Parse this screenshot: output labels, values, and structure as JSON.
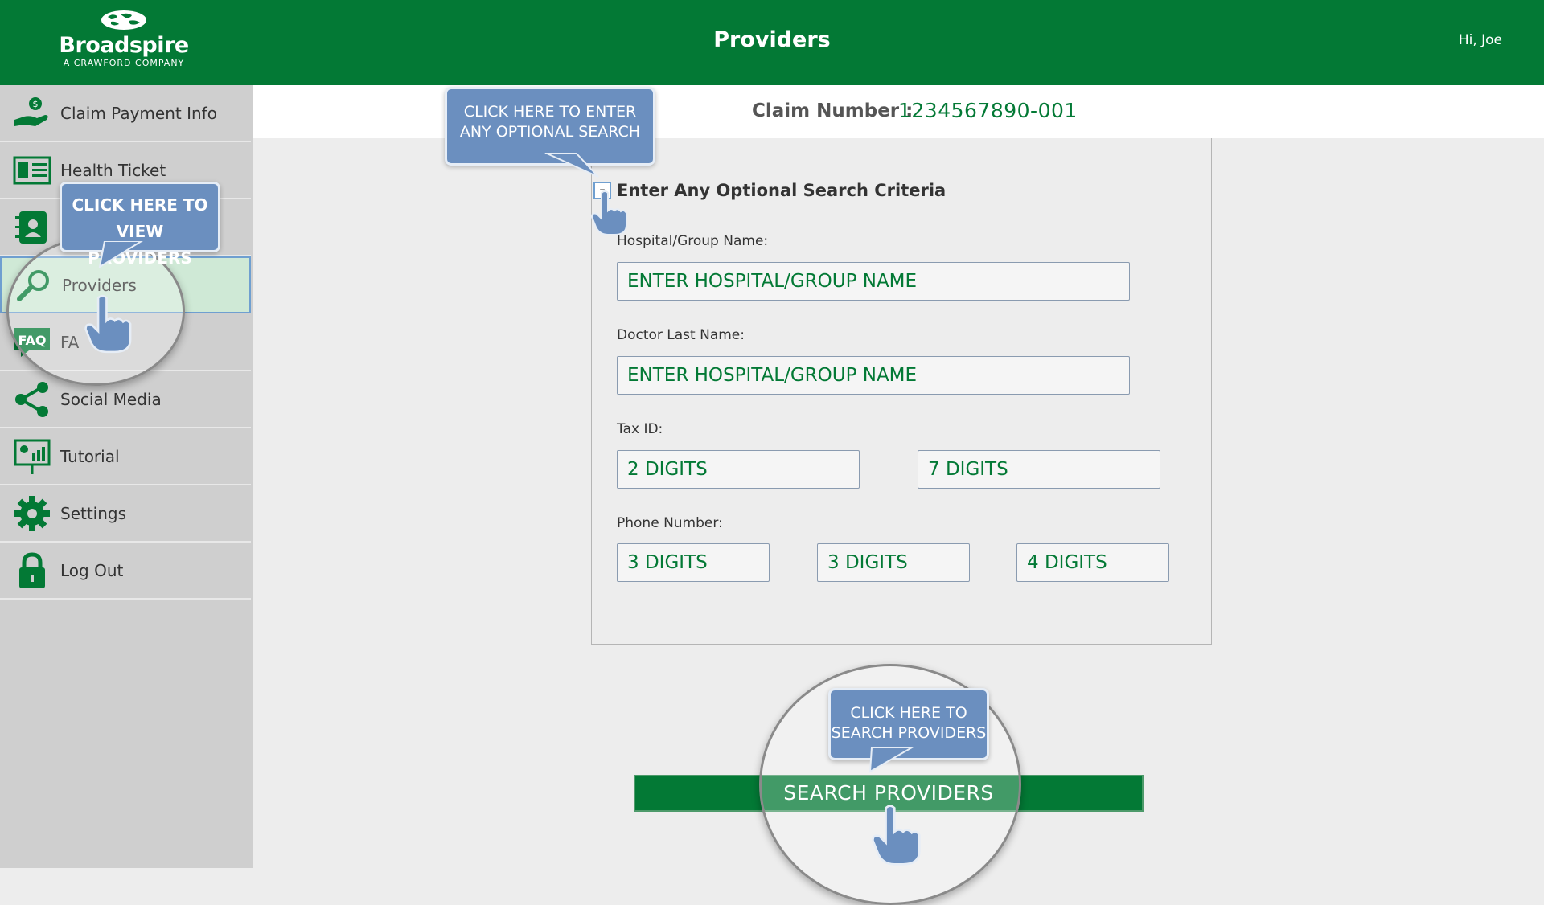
{
  "header": {
    "brand": "Broadspire",
    "tagline": "A CRAWFORD COMPANY",
    "title": "Providers",
    "greeting": "Hi, Joe",
    "background": "#037935"
  },
  "sidebar": {
    "items": [
      {
        "label": "Claim Payment Info",
        "icon": "payment-hand-icon"
      },
      {
        "label": "Health Ticket",
        "icon": "health-ticket-icon"
      },
      {
        "label": "",
        "icon": "contacts-book-icon"
      },
      {
        "label": "Providers",
        "icon": "magnifier-icon",
        "active": true
      },
      {
        "label": "FA",
        "icon": "faq-icon"
      },
      {
        "label": "Social Media",
        "icon": "share-icon"
      },
      {
        "label": "Tutorial",
        "icon": "presentation-icon"
      },
      {
        "label": "Settings",
        "icon": "gear-icon"
      },
      {
        "label": "Log Out",
        "icon": "lock-icon"
      }
    ]
  },
  "claim": {
    "label": "Claim Number :",
    "value": "1234567890-001"
  },
  "optional_search": {
    "checkbox_mark": "–",
    "title": "Enter Any Optional Search Criteria",
    "hospital_label": "Hospital/Group Name:",
    "hospital_placeholder": "ENTER HOSPITAL/GROUP NAME",
    "doctor_label": "Doctor Last Name:",
    "doctor_placeholder": "ENTER HOSPITAL/GROUP NAME",
    "tax_label": "Tax ID:",
    "tax_placeholders": [
      "2 DIGITS",
      "7 DIGITS"
    ],
    "phone_label": "Phone Number:",
    "phone_placeholders": [
      "3 DIGITS",
      "3 DIGITS",
      "4 DIGITS"
    ]
  },
  "search_button": {
    "label": "SEARCH PROVIDERS"
  },
  "tutorial": {
    "bubble_optional": [
      "CLICK HERE TO ENTER",
      "ANY OPTIONAL SEARCH"
    ],
    "bubble_providers": [
      "CLICK HERE TO",
      "VIEW PROVIDERS"
    ],
    "bubble_search": [
      "CLICK HERE TO",
      "SEARCH PROVIDERS"
    ]
  },
  "colors": {
    "brand_green": "#037935",
    "bubble_blue": "#6b8fbf",
    "sidebar_bg": "#cfcfcf",
    "active_item_bg": "#cfe9d6"
  }
}
